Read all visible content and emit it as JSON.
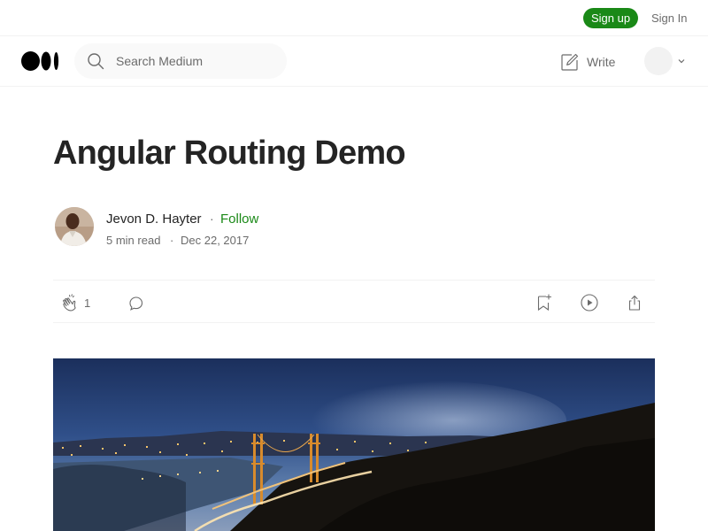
{
  "topbar": {
    "signup_label": "Sign up",
    "signin_label": "Sign In"
  },
  "nav": {
    "logo": "medium-logo",
    "search": {
      "placeholder": "Search Medium",
      "value": ""
    },
    "write_label": "Write"
  },
  "article": {
    "title": "Angular Routing Demo",
    "author": {
      "name": "Jevon D. Hayter",
      "follow_label": "Follow"
    },
    "read_time": "5 min read",
    "date": "Dec 22, 2017",
    "separator": "·",
    "claps": "1",
    "hero_image": "golden-gate-bridge-night-photo"
  },
  "colors": {
    "accent_green": "#1a8917",
    "text": "#242424",
    "muted": "#6b6b6b",
    "border": "#f2f2f2"
  }
}
